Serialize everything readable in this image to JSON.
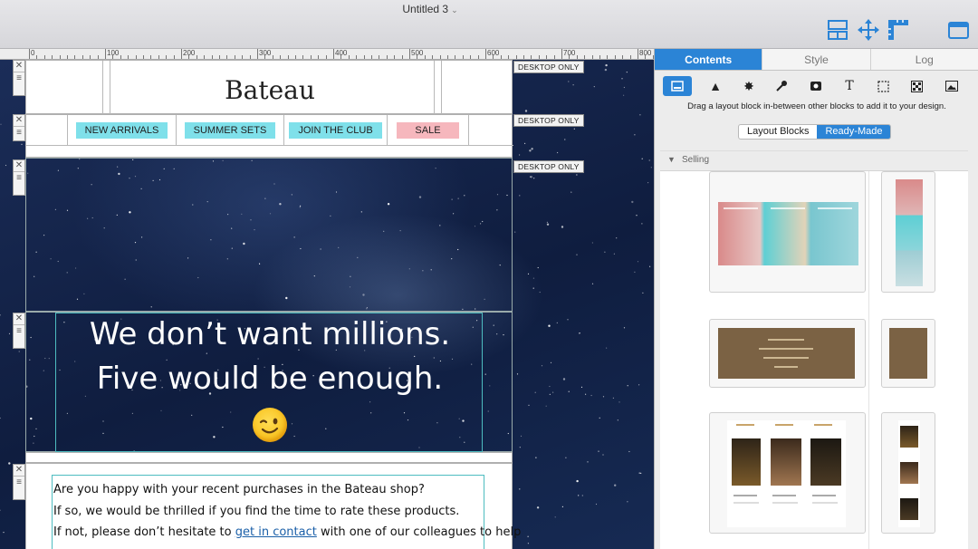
{
  "window": {
    "title": "Untitled 3"
  },
  "toolbar": {
    "icons": [
      "layout-icon",
      "move-icon",
      "ruler-icon",
      "sidebar-toggle-icon"
    ]
  },
  "ruler": {
    "labels": [
      "0",
      "100",
      "200",
      "300",
      "400",
      "500",
      "600",
      "700",
      "800"
    ]
  },
  "canvas": {
    "badges": [
      "DESKTOP ONLY",
      "DESKTOP ONLY",
      "DESKTOP ONLY"
    ],
    "brand": "Bateau",
    "nav": [
      "NEW ARRIVALS",
      "SUMMER SETS",
      "JOIN THE CLUB",
      "SALE"
    ],
    "quote": [
      "We don’t want millions.",
      "Five would be enough."
    ],
    "body": {
      "line1": "Are you happy with your recent purchases in the Bateau shop?",
      "line2": "If so, we would be thrilled if you find the time to rate these products.",
      "line3_before": "If not, please don’t hesitate to ",
      "line3_link": "get in contact",
      "line3_after": " with one of our colleagues to help"
    },
    "colors": {
      "nav_highlight": "#7fe0ea",
      "sale_highlight": "#f6b7bd",
      "accent_outline": "#4dbcc0"
    }
  },
  "panel": {
    "tabs": [
      "Contents",
      "Style",
      "Log"
    ],
    "tools": [
      "layout-block-icon",
      "shape-icon",
      "badge-icon",
      "stamp-icon",
      "media-icon",
      "text-icon",
      "selection-icon",
      "pattern-icon",
      "image-icon"
    ],
    "hint": "Drag a layout block in-between other blocks to add it to your design.",
    "segments": [
      "Layout Blocks",
      "Ready-Made"
    ],
    "category": "Selling",
    "accent": "#2b84d6"
  }
}
